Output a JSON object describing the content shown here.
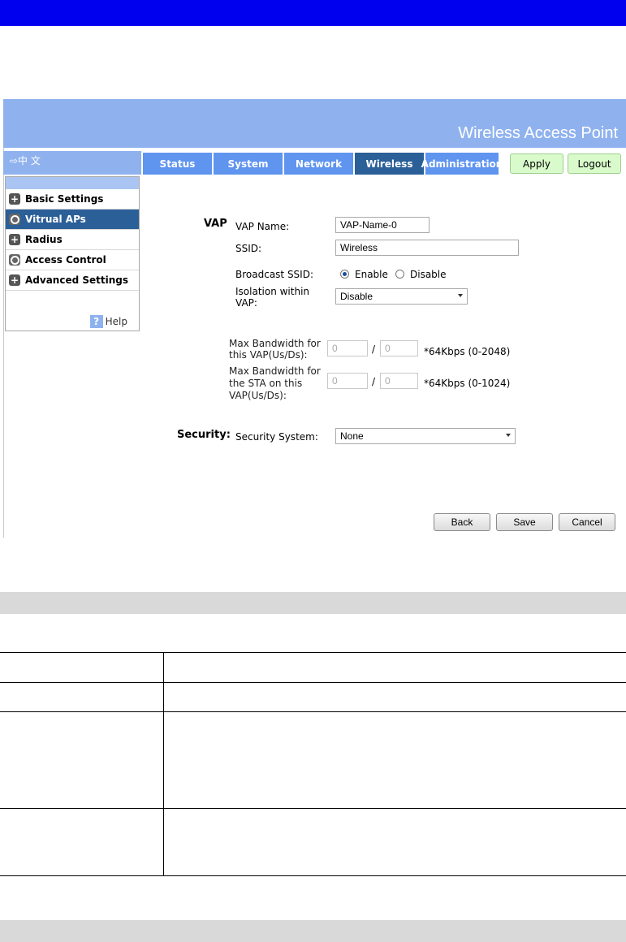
{
  "header": {
    "title": "Wireless Access Point"
  },
  "lang": {
    "label": "⇨中 文"
  },
  "tabs": [
    {
      "label": "Status"
    },
    {
      "label": "System"
    },
    {
      "label": "Network"
    },
    {
      "label": "Wireless"
    },
    {
      "label": "Administration"
    }
  ],
  "top_buttons": {
    "apply": "Apply",
    "logout": "Logout"
  },
  "sidebar": {
    "items": [
      {
        "label": "Basic Settings"
      },
      {
        "label": "Vitrual APs"
      },
      {
        "label": "Radius"
      },
      {
        "label": "Access Control"
      },
      {
        "label": "Advanced Settings"
      }
    ],
    "help": "Help"
  },
  "vap": {
    "section": "VAP",
    "vap_name_label": "VAP Name:",
    "vap_name_value": "VAP-Name-0",
    "ssid_label": "SSID:",
    "ssid_value": "Wireless",
    "broadcast_label": "Broadcast SSID:",
    "enable": "Enable",
    "disable": "Disable",
    "isolation_label_1": "Isolation within",
    "isolation_label_2": "VAP:",
    "isolation_value": "Disable",
    "max_bw_vap_1": "Max Bandwidth for",
    "max_bw_vap_2": "this VAP(Us/Ds):",
    "max_bw_vap_us": "0",
    "max_bw_vap_ds": "0",
    "max_bw_vap_unit": "*64Kbps (0-2048)",
    "max_bw_sta_1": "Max Bandwidth for",
    "max_bw_sta_2": "the STA on this",
    "max_bw_sta_3": "VAP(Us/Ds):",
    "max_bw_sta_us": "0",
    "max_bw_sta_ds": "0",
    "max_bw_sta_unit": "*64Kbps (0-1024)",
    "slash": "/"
  },
  "security": {
    "section": "Security:",
    "system_label": "Security System:",
    "system_value": "None"
  },
  "actions": {
    "back": "Back",
    "save": "Save",
    "cancel": "Cancel"
  },
  "colors": {
    "topbar": "#0000ee",
    "header": "#8fb2ef",
    "tab": "#5f94ef",
    "tab_active": "#2b5f97",
    "green_button": "#d9fbcc"
  }
}
